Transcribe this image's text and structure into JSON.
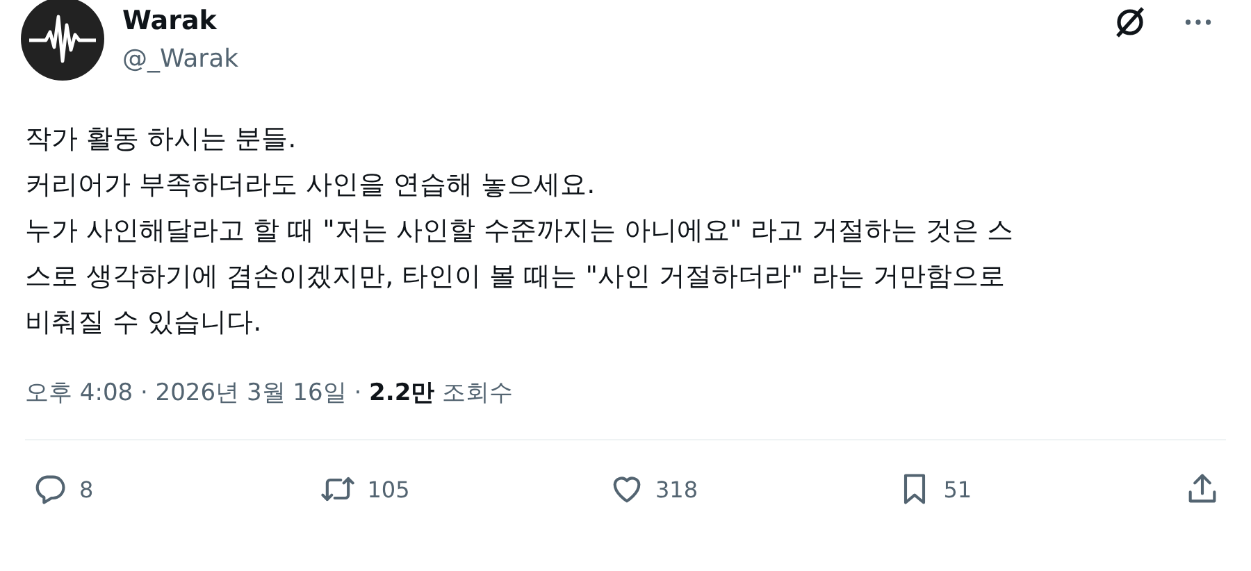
{
  "author": {
    "name": "Warak",
    "handle": "@_Warak"
  },
  "body": {
    "lines": [
      "작가 활동 하시는 분들.",
      "커리어가 부족하더라도 사인을 연습해 놓으세요.",
      "누가 사인해달라고 할 때 \"저는 사인할 수준까지는 아니에요\" 라고 거절하는 것은 스",
      "스로 생각하기에 겸손이겠지만, 타인이 볼 때는 \"사인 거절하더라\" 라는 거만함으로",
      "비춰질 수 있습니다."
    ]
  },
  "meta": "오후 4:08 · 2026년 3월 16일 · **2.2만** 조회수",
  "actions": [
    {
      "kind": "reply",
      "count": "8"
    },
    {
      "kind": "repost",
      "count": "105"
    },
    {
      "kind": "like",
      "count": "318"
    },
    {
      "kind": "bookmark",
      "count": "51"
    },
    {
      "kind": "share"
    }
  ]
}
